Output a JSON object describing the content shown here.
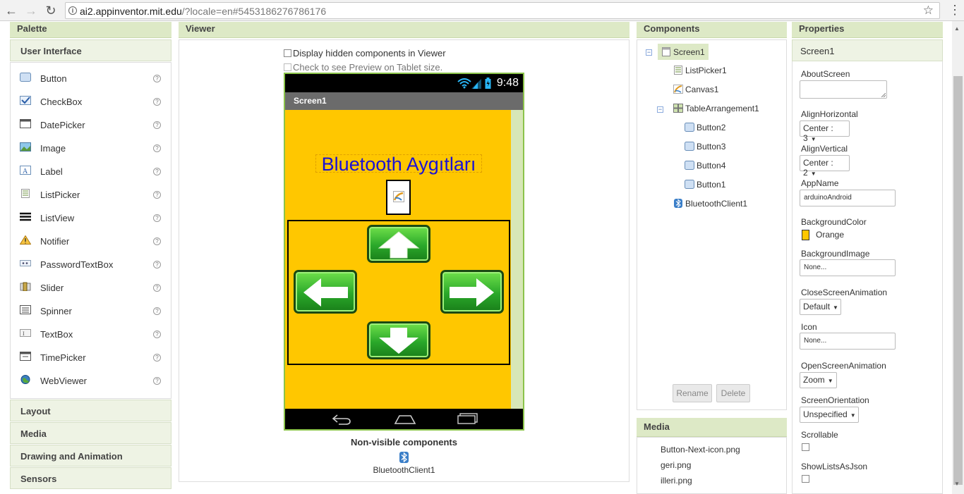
{
  "browser": {
    "url_host": "ai2.appinventor.mit.edu",
    "url_rest": "/?locale=en#5453186276786176"
  },
  "palette": {
    "title": "Palette",
    "category": "User Interface",
    "items": [
      {
        "label": "Button",
        "help": "?"
      },
      {
        "label": "CheckBox",
        "help": "?"
      },
      {
        "label": "DatePicker",
        "help": "?"
      },
      {
        "label": "Image",
        "help": "?"
      },
      {
        "label": "Label",
        "help": "?"
      },
      {
        "label": "ListPicker",
        "help": "?"
      },
      {
        "label": "ListView",
        "help": "?"
      },
      {
        "label": "Notifier",
        "help": "?"
      },
      {
        "label": "PasswordTextBox",
        "help": "?"
      },
      {
        "label": "Slider",
        "help": "?"
      },
      {
        "label": "Spinner",
        "help": "?"
      },
      {
        "label": "TextBox",
        "help": "?"
      },
      {
        "label": "TimePicker",
        "help": "?"
      },
      {
        "label": "WebViewer",
        "help": "?"
      }
    ],
    "other_categories": [
      "Layout",
      "Media",
      "Drawing and Animation",
      "Sensors"
    ]
  },
  "viewer": {
    "title": "Viewer",
    "check_hidden": "Display hidden components in Viewer",
    "check_tablet": "Check to see Preview on Tablet size.",
    "time": "9:48",
    "screen_title": "Screen1",
    "label_text": "Bluetooth Aygıtları",
    "nonvisible_title": "Non-visible components",
    "nonvisible_item": "BluetoothClient1"
  },
  "components": {
    "title": "Components",
    "tree": [
      {
        "label": "Screen1"
      },
      {
        "label": "ListPicker1"
      },
      {
        "label": "Canvas1"
      },
      {
        "label": "TableArrangement1"
      },
      {
        "label": "Button2"
      },
      {
        "label": "Button3"
      },
      {
        "label": "Button4"
      },
      {
        "label": "Button1"
      },
      {
        "label": "BluetoothClient1"
      }
    ],
    "rename": "Rename",
    "delete": "Delete"
  },
  "media": {
    "title": "Media",
    "files": [
      "Button-Next-icon.png",
      "geri.png",
      "illeri.png"
    ]
  },
  "properties": {
    "title": "Properties",
    "component": "Screen1",
    "about_screen": "AboutScreen",
    "align_h": "AlignHorizontal",
    "align_h_value": "Center : 3",
    "align_v": "AlignVertical",
    "align_v_value": "Center : 2",
    "app_name": "AppName",
    "app_name_value": "arduinoAndroid",
    "bg_color": "BackgroundColor",
    "bg_color_value": "Orange",
    "bg_color_hex": "#ffc700",
    "bg_image": "BackgroundImage",
    "bg_image_value": "None...",
    "close_anim": "CloseScreenAnimation",
    "close_anim_value": "Default",
    "icon": "Icon",
    "icon_value": "None...",
    "open_anim": "OpenScreenAnimation",
    "open_anim_value": "Zoom",
    "orientation": "ScreenOrientation",
    "orientation_value": "Unspecified",
    "scrollable": "Scrollable",
    "show_lists": "ShowListsAsJson"
  }
}
